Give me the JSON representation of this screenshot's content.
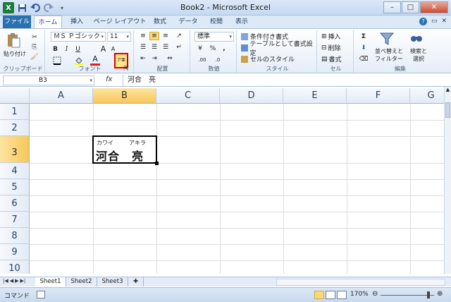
{
  "window": {
    "title": "Book2 - Microsoft Excel",
    "app_icon_letter": "X"
  },
  "qat": {
    "save_icon": "save-icon",
    "undo_icon": "undo-icon",
    "redo_icon": "redo-icon"
  },
  "tabs": [
    "ファイル",
    "ホーム",
    "挿入",
    "ページ レイアウト",
    "数式",
    "データ",
    "校閲",
    "表示"
  ],
  "ribbon": {
    "clipboard": {
      "paste_label": "貼り付け",
      "group_label": "クリップボード"
    },
    "font": {
      "font_name": "ＭＳ Ｐゴシック",
      "font_size": "11",
      "bold": "B",
      "italic": "I",
      "underline": "U",
      "grow": "A",
      "shrink": "A",
      "font_color": "A",
      "phonetic": "ア亜",
      "group_label": "フォント"
    },
    "alignment": {
      "group_label": "配置"
    },
    "number": {
      "format": "標準",
      "percent": "%",
      "comma": ",",
      "group_label": "数値"
    },
    "styles": {
      "conditional": "条件付き書式",
      "table": "テーブルとして書式設定",
      "cell_styles": "セルのスタイル",
      "group_label": "スタイル"
    },
    "cells": {
      "insert": "挿入",
      "delete": "削除",
      "format": "書式",
      "group_label": "セル"
    },
    "editing": {
      "sum": "Σ",
      "sort_line1": "並べ替えと",
      "sort_line2": "フィルター",
      "find_line1": "検索と",
      "find_line2": "選択",
      "group_label": "編集"
    }
  },
  "formula_bar": {
    "name_box": "B3",
    "fx": "fx",
    "content": "河合　亮"
  },
  "columns": [
    "A",
    "B",
    "C",
    "D",
    "E",
    "F",
    "G"
  ],
  "rows": [
    "1",
    "2",
    "3",
    "4",
    "5",
    "6",
    "7",
    "8",
    "9",
    "10"
  ],
  "cell_b3": {
    "value": "河合　亮",
    "furigana_family": "カワイ",
    "furigana_given": "アキラ"
  },
  "sheets": [
    "Sheet1",
    "Sheet2",
    "Sheet3"
  ],
  "status": {
    "mode": "コマンド",
    "zoom": "170%",
    "zoom_fraction": 0.85
  }
}
